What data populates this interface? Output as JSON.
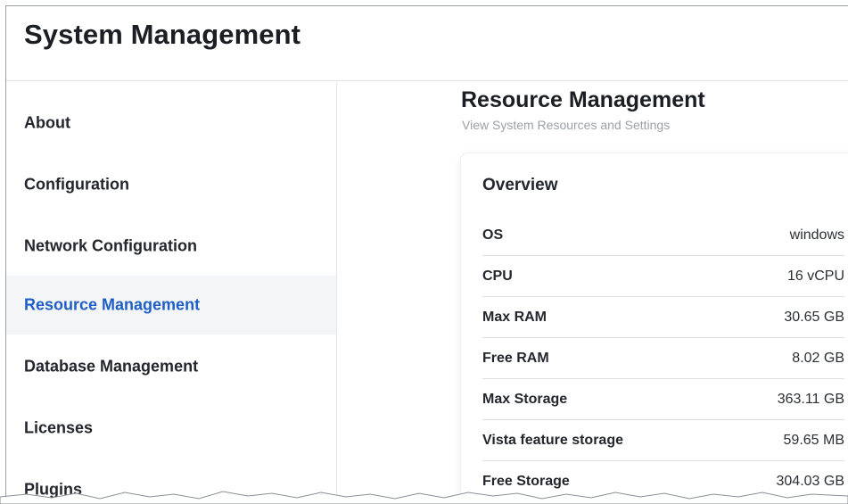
{
  "app": {
    "title": "System Management"
  },
  "sidebar": {
    "items": [
      {
        "label": "About",
        "active": false
      },
      {
        "label": "Configuration",
        "active": false
      },
      {
        "label": "Network Configuration",
        "active": false
      },
      {
        "label": "Resource Management",
        "active": true
      },
      {
        "label": "Database Management",
        "active": false
      },
      {
        "label": "Licenses",
        "active": false
      },
      {
        "label": "Plugins",
        "active": false
      }
    ]
  },
  "main": {
    "title": "Resource Management",
    "subtitle": "View System Resources and Settings",
    "overview": {
      "title": "Overview",
      "rows": [
        {
          "key": "OS",
          "value": "windows"
        },
        {
          "key": "CPU",
          "value": "16 vCPU"
        },
        {
          "key": "Max RAM",
          "value": "30.65 GB"
        },
        {
          "key": "Free RAM",
          "value": "8.02 GB"
        },
        {
          "key": "Max Storage",
          "value": "363.11 GB"
        },
        {
          "key": "Vista feature storage",
          "value": "59.65 MB"
        },
        {
          "key": "Free Storage",
          "value": "304.03 GB"
        }
      ]
    }
  },
  "colors": {
    "accent": "#1f5fc5",
    "active_bg": "#f4f5f7",
    "muted": "#9aa1a9"
  }
}
